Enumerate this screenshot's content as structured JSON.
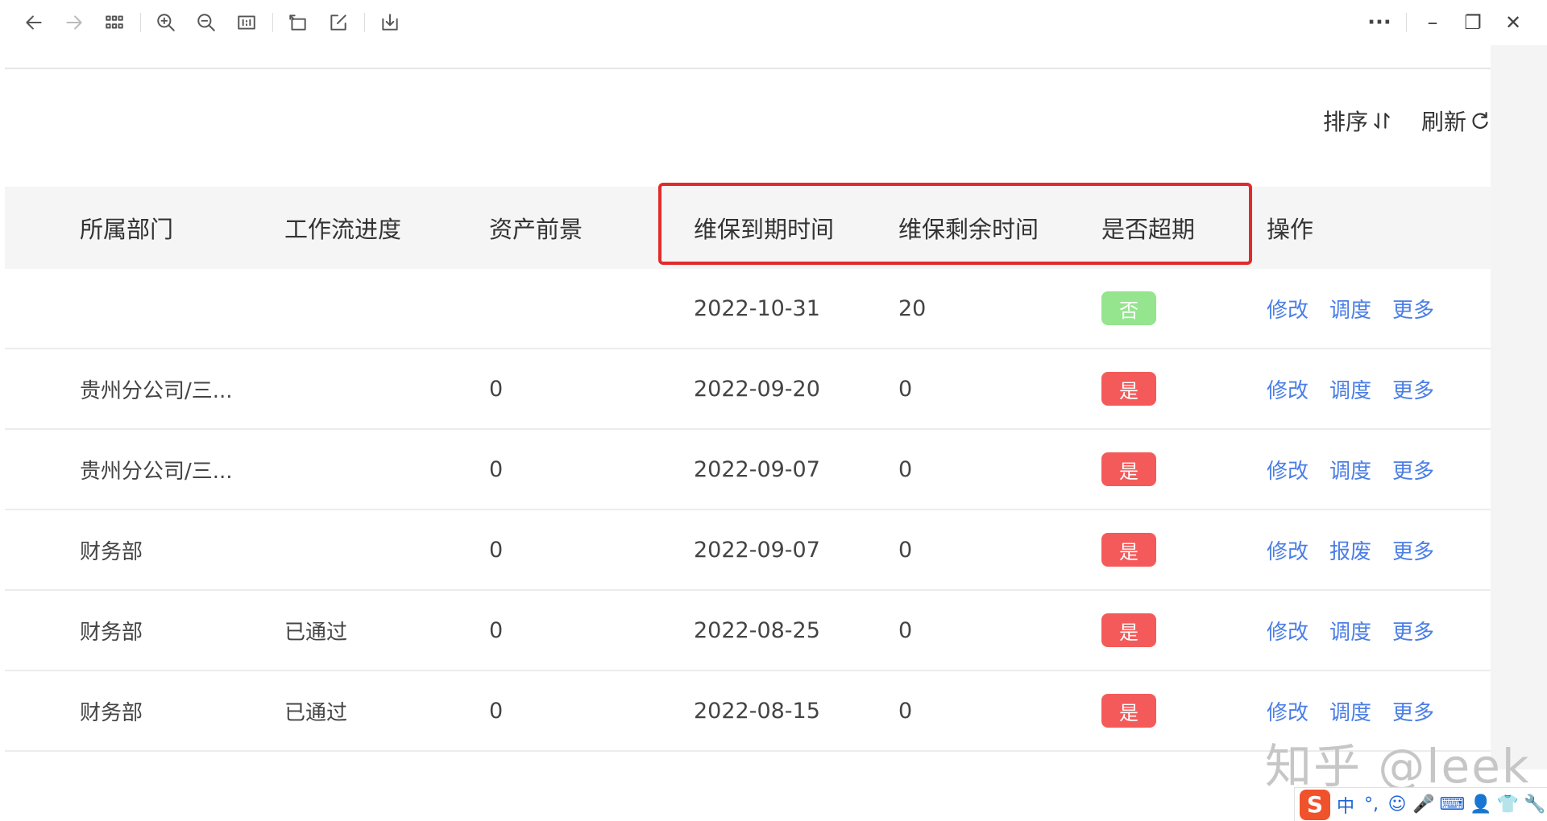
{
  "toolbar": {
    "icons": [
      "back-arrow-icon",
      "forward-arrow-icon",
      "grid-icon",
      "zoom-in-icon",
      "zoom-out-icon",
      "actual-size-icon",
      "rotate-icon",
      "edit-icon",
      "save-icon",
      "more-icon",
      "minimize-icon",
      "restore-icon",
      "close-icon"
    ],
    "more": "···",
    "minimize": "–",
    "restore": "❐",
    "close": "✕"
  },
  "actions": {
    "sort_label": "排序",
    "refresh_label": "刷新"
  },
  "table": {
    "columns": [
      "所属部门",
      "工作流进度",
      "资产前景",
      "维保到期时间",
      "维保剩余时间",
      "是否超期",
      "操作"
    ],
    "rows": [
      {
        "dept": "",
        "progress": "",
        "prospect": "",
        "expiry": "2022-10-31",
        "remaining": "20",
        "overdue": "否",
        "ops": [
          "修改",
          "调度",
          "更多"
        ]
      },
      {
        "dept": "贵州分公司/三...",
        "progress": "",
        "prospect": "0",
        "expiry": "2022-09-20",
        "remaining": "0",
        "overdue": "是",
        "ops": [
          "修改",
          "调度",
          "更多"
        ]
      },
      {
        "dept": "贵州分公司/三...",
        "progress": "",
        "prospect": "0",
        "expiry": "2022-09-07",
        "remaining": "0",
        "overdue": "是",
        "ops": [
          "修改",
          "调度",
          "更多"
        ]
      },
      {
        "dept": "财务部",
        "progress": "",
        "prospect": "0",
        "expiry": "2022-09-07",
        "remaining": "0",
        "overdue": "是",
        "ops": [
          "修改",
          "报废",
          "更多"
        ]
      },
      {
        "dept": "财务部",
        "progress": "已通过",
        "prospect": "0",
        "expiry": "2022-08-25",
        "remaining": "0",
        "overdue": "是",
        "ops": [
          "修改",
          "调度",
          "更多"
        ]
      },
      {
        "dept": "财务部",
        "progress": "已通过",
        "prospect": "0",
        "expiry": "2022-08-15",
        "remaining": "0",
        "overdue": "是",
        "ops": [
          "修改",
          "调度",
          "更多"
        ]
      }
    ]
  },
  "colors": {
    "highlight": "#e12b2b",
    "badge_no": "#95e48e",
    "badge_yes": "#f45a5a",
    "link": "#4b7ee6"
  },
  "watermark": "知乎 @leek",
  "ime": {
    "logo": "S",
    "items": [
      "中",
      "°,",
      "☺",
      "🎤",
      "⌨",
      "👤",
      "👕",
      "🔧"
    ]
  }
}
